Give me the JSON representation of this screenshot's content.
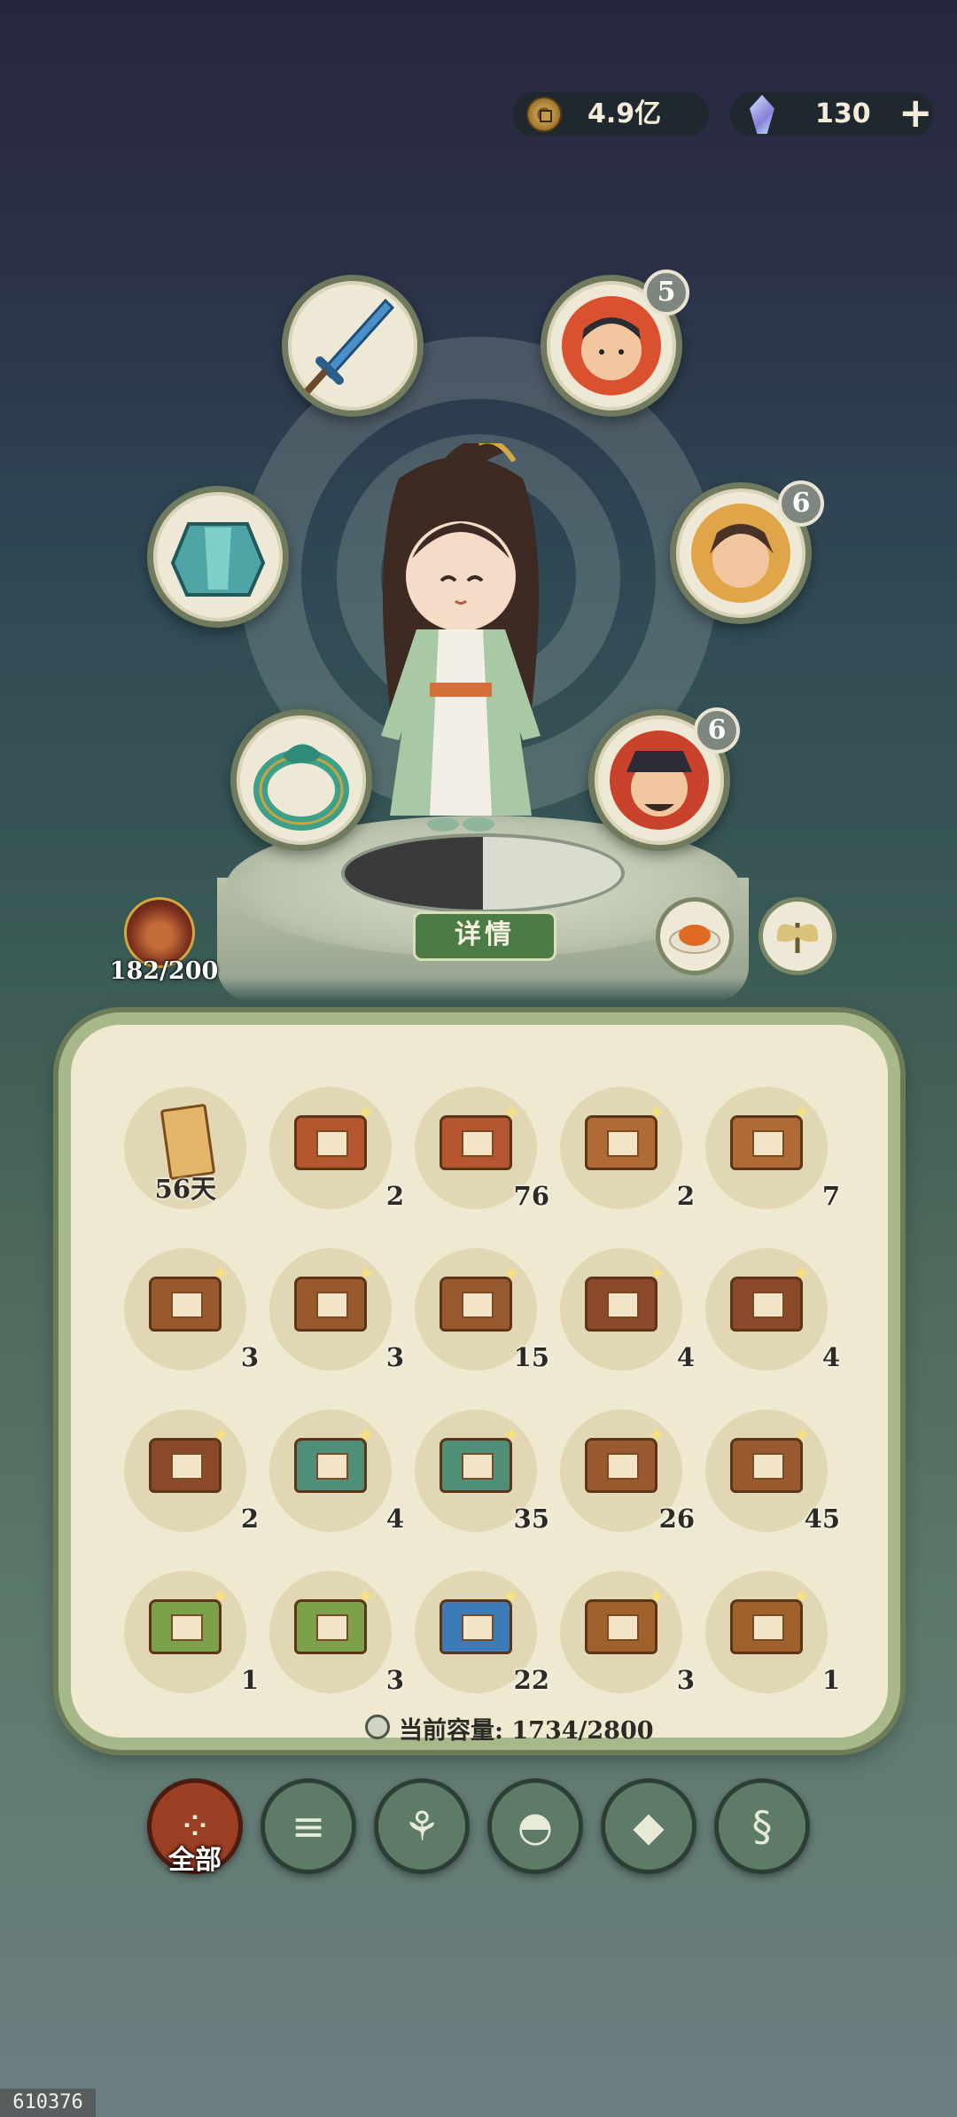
{
  "currency": {
    "coins": "4.9亿",
    "gems": "130",
    "coin_icon": "copper-coin-icon",
    "gem_icon": "crystal-gem-icon",
    "add_icon": "plus-icon"
  },
  "equipment": {
    "weapon_icon": "sword-icon",
    "armor_icon": "armor-icon",
    "ring_icon": "jade-ring-icon",
    "companions": [
      {
        "icon": "companion-boy-portrait",
        "level": "5"
      },
      {
        "icon": "companion-hero-portrait",
        "level": "6"
      },
      {
        "icon": "companion-official-portrait",
        "level": "6"
      }
    ]
  },
  "character": {
    "details_label": "详情",
    "stamina": "182/200",
    "stamina_icon": "monkey-spirit-icon",
    "food_icon": "food-plate-icon",
    "moth_icon": "moth-icon"
  },
  "inventory": {
    "items": [
      {
        "icon": "scroll-icon",
        "count": "56天"
      },
      {
        "icon": "red-chest-icon",
        "count": "2"
      },
      {
        "icon": "red-chest-icon",
        "count": "76"
      },
      {
        "icon": "brown-chest-icon",
        "count": "2"
      },
      {
        "icon": "brown-chest-icon",
        "count": "7"
      },
      {
        "icon": "stone-chest-icon",
        "count": "3"
      },
      {
        "icon": "stone-chest-icon",
        "count": "3"
      },
      {
        "icon": "stone-chest-icon",
        "count": "15"
      },
      {
        "icon": "stone-chest-icon",
        "count": "4"
      },
      {
        "icon": "stone-chest-icon",
        "count": "4"
      },
      {
        "icon": "log-chest-icon",
        "count": "2"
      },
      {
        "icon": "green-chest-icon",
        "count": "4"
      },
      {
        "icon": "green-chest-icon",
        "count": "35"
      },
      {
        "icon": "herb-chest-icon",
        "count": "26"
      },
      {
        "icon": "herb-chest-icon",
        "count": "45"
      },
      {
        "icon": "bamboo-chest-icon",
        "count": "1"
      },
      {
        "icon": "bamboo-chest-icon",
        "count": "3"
      },
      {
        "icon": "blue-chest-icon",
        "count": "22"
      },
      {
        "icon": "gold-chest-icon",
        "count": "3"
      },
      {
        "icon": "gold-chest-icon",
        "count": "1"
      }
    ],
    "capacity": "当前容量: 1734/2800"
  },
  "tabs": [
    {
      "name": "all",
      "label": "全部",
      "icon": "grid-icon",
      "glyph": "⁘"
    },
    {
      "name": "wood",
      "label": "",
      "icon": "log-icon",
      "glyph": "≡"
    },
    {
      "name": "herb",
      "label": "",
      "icon": "herb-icon",
      "glyph": "⚘"
    },
    {
      "name": "food",
      "label": "",
      "icon": "rice-bowl-icon",
      "glyph": "◓"
    },
    {
      "name": "ore",
      "label": "",
      "icon": "ore-icon",
      "glyph": "◆"
    },
    {
      "name": "scroll",
      "label": "",
      "icon": "scroll-icon",
      "glyph": "§"
    }
  ],
  "watermark": "610376"
}
